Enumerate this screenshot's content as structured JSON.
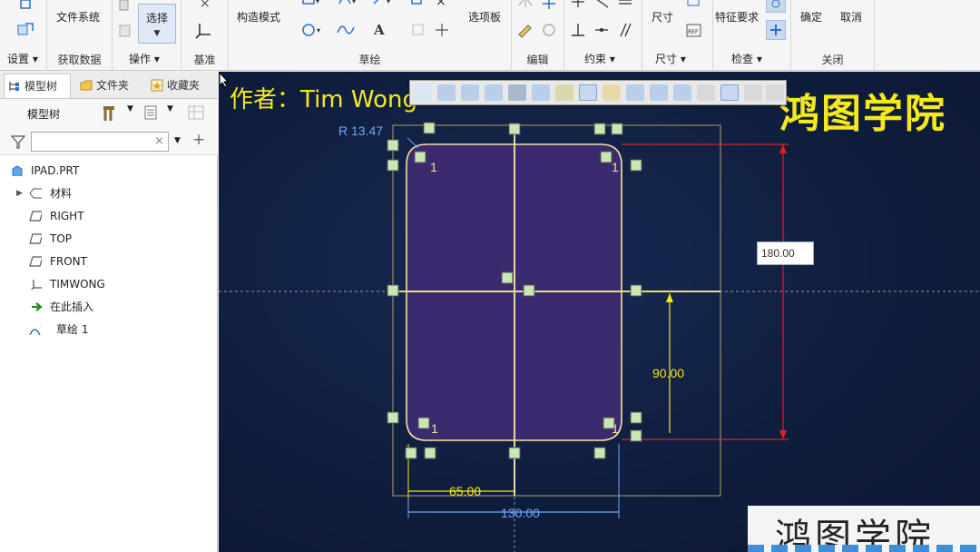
{
  "ribbon": {
    "groups": {
      "setup": "设置",
      "get_data": "获取数据",
      "operations": "操作",
      "datum": "基准",
      "sketching": "草绘",
      "editing": "编辑",
      "constrain": "约束",
      "dimension": "尺寸",
      "inspect": "检查",
      "close": "关闭"
    },
    "buttons": {
      "file_system": "文件系统",
      "select": "选择",
      "construction_mode": "构造模式",
      "palette": "选项板",
      "dimension": "尺寸",
      "feature_requirements": "特征要求",
      "ok": "确定",
      "cancel": "取消",
      "text_tool": "A"
    }
  },
  "left_panel": {
    "tabs": [
      "模型树",
      "文件夹",
      "收藏夹"
    ],
    "tree_header": "模型树",
    "filter_placeholder": "",
    "tree": [
      {
        "label": "IPAD.PRT",
        "icon": "part-icon"
      },
      {
        "label": "材料",
        "icon": "material-icon"
      },
      {
        "label": "RIGHT",
        "icon": "datum-plane-icon"
      },
      {
        "label": "TOP",
        "icon": "datum-plane-icon"
      },
      {
        "label": "FRONT",
        "icon": "datum-plane-icon"
      },
      {
        "label": "TIMWONG",
        "icon": "coordinate-system-icon"
      },
      {
        "label": "在此插入",
        "icon": "insert-here-icon"
      },
      {
        "label": "草绘 1",
        "icon": "sketch-icon"
      }
    ]
  },
  "graphics": {
    "author_text": "作者：Tim Wong",
    "brand_top": "鸿图学院",
    "brand_bottom": "鸿图学院",
    "dimensions": {
      "radius": "R 13.47",
      "height": "180.00",
      "half_height": "90.00",
      "half_width": "65.00",
      "width": "130.00",
      "tangent_marks": [
        "1",
        "1",
        "1",
        "1"
      ]
    }
  },
  "colors": {
    "background": "#0f1d3c",
    "sketch_fill": "#3b2a6e",
    "sketch_line": "#f4e3a0",
    "dimension_red": "#e02020",
    "dimension_yellow": "#f4e91c",
    "dimension_blue": "#6fa8ff",
    "constraint_badge": "#c9e7b4"
  }
}
